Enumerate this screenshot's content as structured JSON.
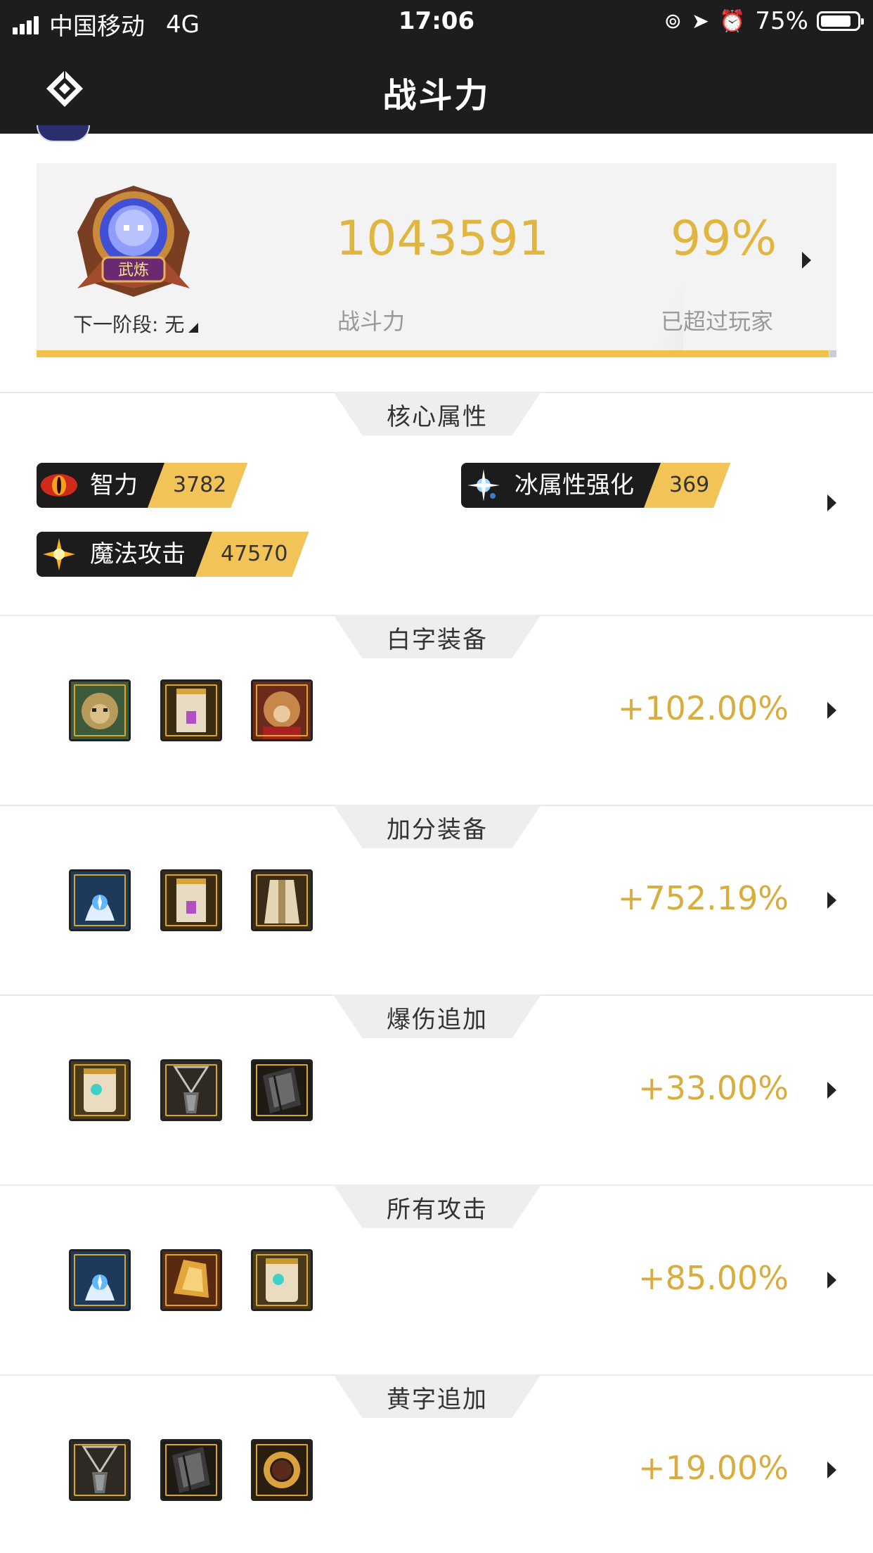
{
  "status_bar": {
    "carrier": "中国移动",
    "network": "4G",
    "time": "17:06",
    "battery": "75%"
  },
  "nav": {
    "title": "战斗力",
    "logo_icon": "diamond-logo-icon"
  },
  "summary": {
    "badge_text": "武炼",
    "next_stage": "下一阶段: 无",
    "power_value": "1043591",
    "power_label": "战斗力",
    "percent_value": "99%",
    "percent_label": "已超过玩家",
    "progress_fraction": 0.99,
    "accent_color": "#e0b640"
  },
  "core": {
    "title": "核心属性",
    "attributes": [
      {
        "name": "智力",
        "value": "3782",
        "icon": "eye-icon"
      },
      {
        "name": "冰属性强化",
        "value": "369",
        "icon": "ice-sparkle-icon"
      },
      {
        "name": "魔法攻击",
        "value": "47570",
        "icon": "burst-icon"
      }
    ]
  },
  "sections": [
    {
      "title": "白字装备",
      "bonus": "+102.00%",
      "items": [
        "lion-helm-item-icon",
        "gold-armor-item-icon",
        "beast-warrior-item-icon"
      ]
    },
    {
      "title": "加分装备",
      "bonus": "+752.19%",
      "items": [
        "ice-mage-item-icon",
        "gold-armor-item-icon",
        "robe-item-icon"
      ]
    },
    {
      "title": "爆伤追加",
      "bonus": "+33.00%",
      "items": [
        "gem-armor-item-icon",
        "pendant-item-icon",
        "bracer-item-icon"
      ]
    },
    {
      "title": "所有攻击",
      "bonus": "+85.00%",
      "items": [
        "ice-mage-item-icon",
        "gold-gauntlet-item-icon",
        "gem-armor-item-icon"
      ]
    },
    {
      "title": "黄字追加",
      "bonus": "+19.00%",
      "items": [
        "pendant-item-icon",
        "bracer-item-icon",
        "ring-item-icon"
      ]
    }
  ]
}
